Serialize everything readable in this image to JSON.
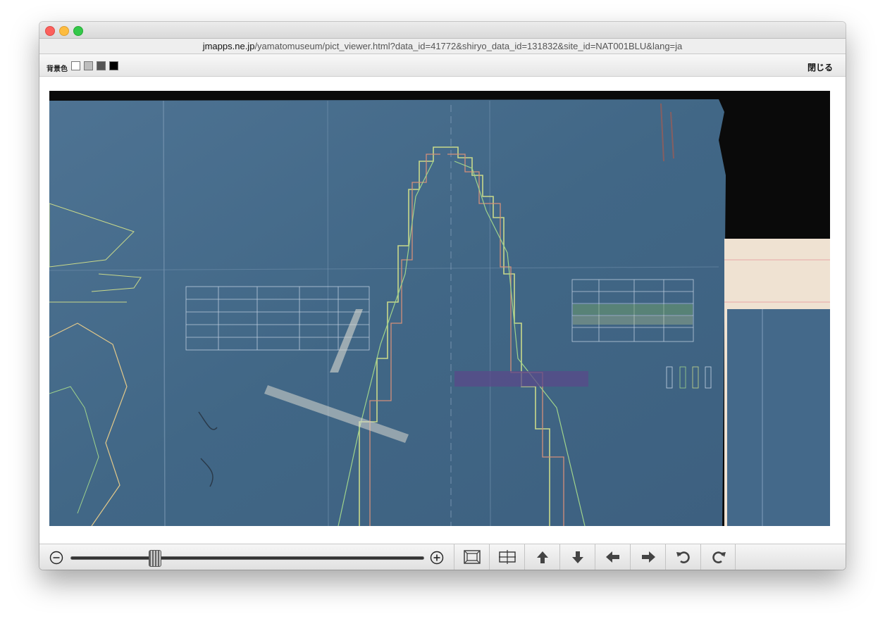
{
  "window": {
    "url_domain": "jmapps.ne.jp",
    "url_path": "/yamatomuseum/pict_viewer.html?data_id=41772&shiryo_data_id=131832&site_id=NAT001BLU&lang=ja"
  },
  "toolbar": {
    "background_label": "背景色",
    "swatches": [
      "#ffffff",
      "#bdbdbd",
      "#555555",
      "#000000"
    ],
    "close_label": "閉じる"
  },
  "viewer": {
    "zoom_level": 0.23
  },
  "controls": {
    "icons": [
      "zoom-out-icon",
      "zoom-in-icon",
      "fit-screen-icon",
      "actual-size-icon",
      "arrow-up-icon",
      "arrow-down-icon",
      "arrow-left-icon",
      "arrow-right-icon",
      "rotate-left-icon",
      "rotate-right-icon"
    ]
  }
}
